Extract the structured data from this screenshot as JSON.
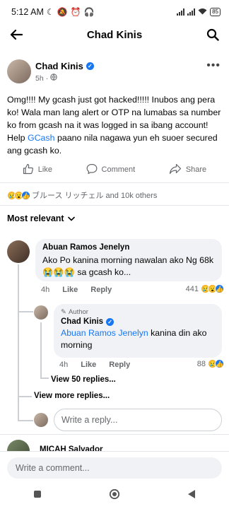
{
  "status_bar": {
    "time": "5:12 AM",
    "battery": "85"
  },
  "header": {
    "title": "Chad Kinis"
  },
  "post": {
    "author": "Chad Kinis",
    "time": "5h",
    "body_before_link": "Omg!!!! My gcash just got hacked!!!!! Inubos ang pera ko! Wala man lang alert or OTP na lumabas sa number ko from gcash na it was logged in sa ibang account! Help ",
    "body_link": "GCash",
    "body_after_link": " paano nila nagawa yun eh suoer secured ang gcash ko."
  },
  "actions": {
    "like": "Like",
    "comment": "Comment",
    "share": "Share"
  },
  "reactions": {
    "summary": "ブルース リッチェル and 10k others"
  },
  "sort": {
    "label": "Most relevant"
  },
  "comments": [
    {
      "author": "Abuan Ramos Jenelyn",
      "text": "Ako Po kanina morning nawalan ako Ng 68k😭😭😭 sa gcash ko...",
      "time": "4h",
      "like": "Like",
      "reply": "Reply",
      "count": "441"
    }
  ],
  "reply": {
    "badge": "Author",
    "author": "Chad Kinis",
    "mention": "Abuan Ramos Jenelyn",
    "text": " kanina din ako morning",
    "time": "4h",
    "like": "Like",
    "reply": "Reply",
    "count": "88"
  },
  "view_replies": "View 50 replies...",
  "view_more_replies": "View more replies...",
  "reply_placeholder": "Write a reply...",
  "next_comment_author": "MICAH Salvador",
  "composer_placeholder": "Write a comment..."
}
